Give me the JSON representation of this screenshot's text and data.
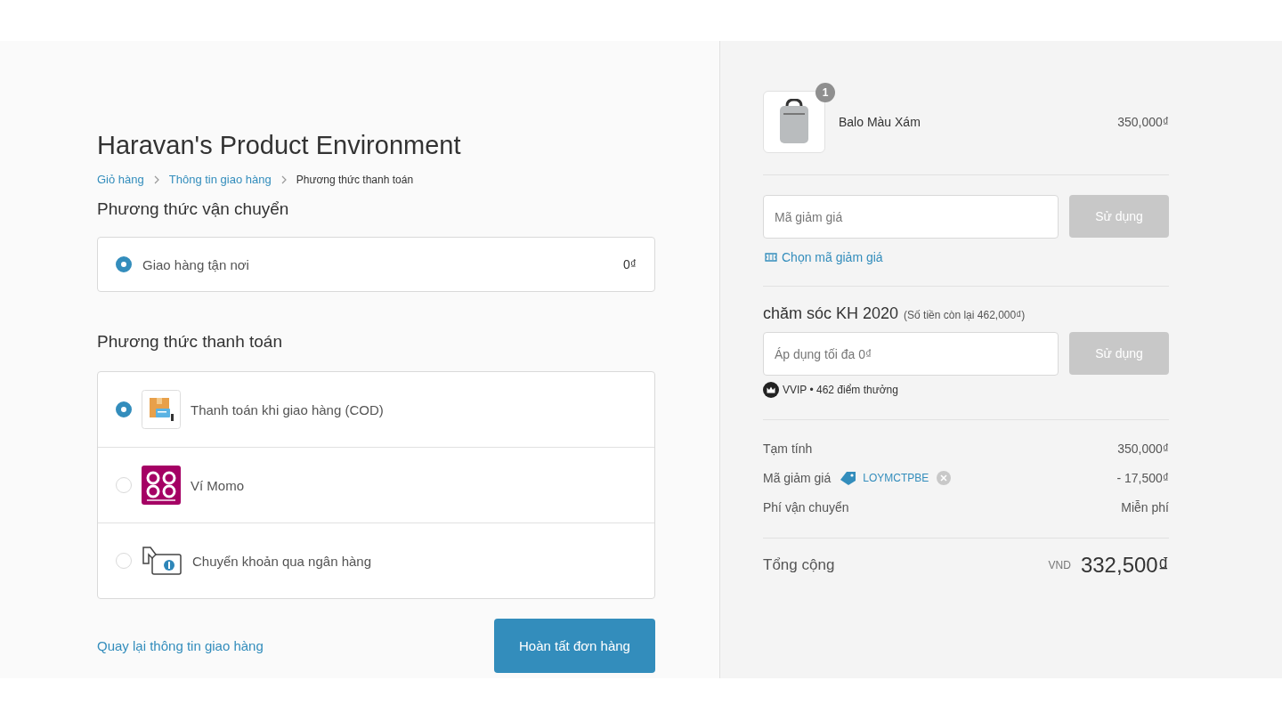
{
  "store_title": "Haravan's Product Environment",
  "breadcrumb": [
    {
      "label": "Giỏ hàng",
      "selected": false
    },
    {
      "label": "Thông tin giao hàng",
      "selected": false
    },
    {
      "label": "Phương thức thanh toán",
      "selected": true
    }
  ],
  "shipping": {
    "heading": "Phương thức vận chuyển",
    "options": [
      {
        "label": "Giao hàng tận nơi",
        "price": "0₫",
        "selected": true
      }
    ]
  },
  "payment": {
    "heading": "Phương thức thanh toán",
    "methods": [
      {
        "kind": "cod",
        "label": "Thanh toán khi giao hàng (COD)",
        "selected": true
      },
      {
        "kind": "momo",
        "label": "Ví Momo",
        "selected": false
      },
      {
        "kind": "bank",
        "label": "Chuyển khoản qua ngân hàng",
        "selected": false
      }
    ]
  },
  "back_link": "Quay lại thông tin giao hàng",
  "submit_button": "Hoàn tất đơn hàng",
  "summary": {
    "items": [
      {
        "name": "Balo Màu Xám",
        "quantity": "1",
        "price": "350,000₫"
      }
    ],
    "discount": {
      "placeholder": "Mã giảm giá",
      "button": "Sử dụng",
      "disabled": true,
      "choose_link": "Chọn mã giảm giá"
    },
    "loyalty": {
      "title": "chăm sóc KH 2020",
      "balance_note": "(Số tiền còn lại 462,000₫)",
      "placeholder": "Áp dụng tối đa 0₫",
      "button": "Sử dụng",
      "disabled": true,
      "tier": "VVIP • 462 điểm thưởng"
    },
    "lines": [
      {
        "label": "Tạm tính",
        "value": "350,000₫"
      },
      {
        "label": "Mã giảm giá",
        "code": "LOYMCTPBE",
        "value": "- 17,500₫"
      },
      {
        "label": "Phí vận chuyển",
        "value": "Miễn phí"
      }
    ],
    "total": {
      "label": "Tổng cộng",
      "currency": "VND",
      "amount": "332,500₫"
    }
  }
}
